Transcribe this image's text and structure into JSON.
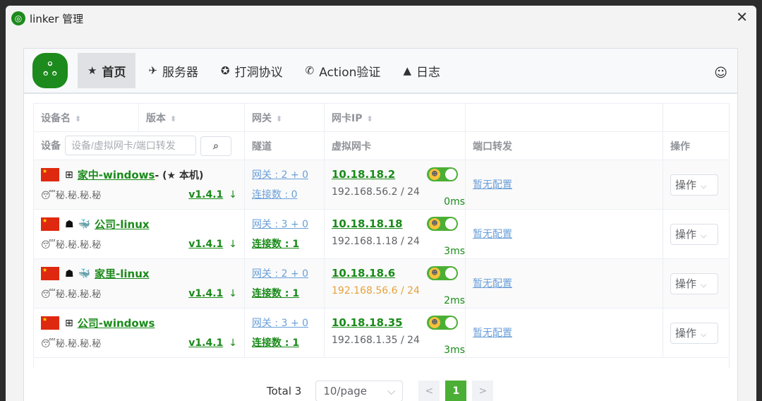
{
  "window": {
    "title": "linker 管理",
    "close": "✕"
  },
  "nav": {
    "items": [
      {
        "icon": "★",
        "label": "首页"
      },
      {
        "icon": "✈",
        "label": "服务器"
      },
      {
        "icon": "✪",
        "label": "打洞协议"
      },
      {
        "icon": "✆",
        "label": "Action验证"
      },
      {
        "icon": "▲",
        "label": "日志"
      }
    ]
  },
  "table": {
    "headers": [
      "设备名",
      "版本",
      "网关",
      "网卡IP"
    ],
    "filter": {
      "label": "设备",
      "placeholder": "设备/虚拟网卡/端口转发",
      "tunnel": "隧道",
      "vnic": "虚拟网卡",
      "forward": "端口转发",
      "ops": "操作"
    },
    "rows": [
      {
        "name": "家中-windows",
        "suffix": " - (★ 本机)",
        "os": "windows",
        "secret": "秘.秘.秘.秘",
        "version": "v1.4.1",
        "gateway": "网关 : 2 + 0",
        "conns": "连接数 : 0",
        "conns_active": false,
        "vip": "10.18.18.2",
        "lan": "192.168.56.2 / 24",
        "lan_warn": false,
        "latency": "0ms",
        "forward": "暂无配置",
        "op": "操作"
      },
      {
        "name": "公司-linux",
        "suffix": "",
        "os": "linux",
        "secret": "秘.秘.秘.秘",
        "version": "v1.4.1",
        "gateway": "网关 : 3 + 0",
        "conns": "连接数 : 1",
        "conns_active": true,
        "vip": "10.18.18.18",
        "lan": "192.168.1.18 / 24",
        "lan_warn": false,
        "latency": "3ms",
        "forward": "暂无配置",
        "op": "操作"
      },
      {
        "name": "家里-linux",
        "suffix": "",
        "os": "linux",
        "secret": "秘.秘.秘.秘",
        "version": "v1.4.1",
        "gateway": "网关 : 2 + 0",
        "conns": "连接数 : 1",
        "conns_active": true,
        "vip": "10.18.18.6",
        "lan": "192.168.56.6 / 24",
        "lan_warn": true,
        "latency": "2ms",
        "forward": "暂无配置",
        "op": "操作"
      },
      {
        "name": "公司-windows",
        "suffix": "",
        "os": "windows",
        "secret": "秘.秘.秘.秘",
        "version": "v1.4.1",
        "gateway": "网关 : 3 + 0",
        "conns": "连接数 : 1",
        "conns_active": true,
        "vip": "10.18.18.35",
        "lan": "192.168.1.35 / 24",
        "lan_warn": false,
        "latency": "3ms",
        "forward": "暂无配置",
        "op": "操作"
      }
    ]
  },
  "pager": {
    "total": "Total 3",
    "size": "10/page",
    "page": "1",
    "prev": "<",
    "next": ">"
  }
}
